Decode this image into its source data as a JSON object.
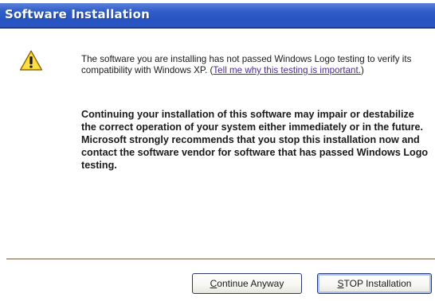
{
  "window": {
    "title": "Software Installation"
  },
  "icons": {
    "warning": "warning-triangle-icon"
  },
  "message": {
    "para1_text": "The software you are installing has not passed Windows Logo testing to verify its compatibility with Windows XP. (",
    "para1_link": "Tell me why this testing is important.",
    "para1_close": ")",
    "para2_text": "Continuing your installation of this software may impair or destabilize the correct operation of your system either immediately or in the future. Microsoft strongly recommends that you stop this installation now and contact the software vendor for software that has passed Windows Logo testing."
  },
  "buttons": {
    "continue_mnemonic": "C",
    "continue_rest": "ontinue Anyway",
    "stop_mnemonic": "S",
    "stop_rest": "TOP Installation"
  },
  "colors": {
    "titlebar": "#2f5dc9",
    "link": "#4a2b8c",
    "separator": "#b9a58a"
  }
}
